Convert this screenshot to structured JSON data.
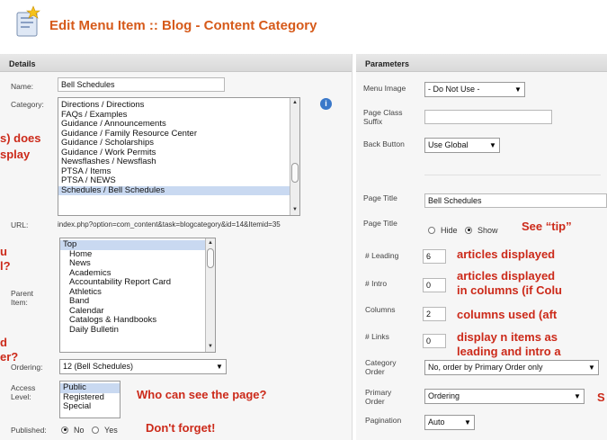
{
  "header": {
    "title": "Edit Menu Item :: Blog - Content Category"
  },
  "details": {
    "heading": "Details",
    "name_label": "Name:",
    "name_value": "Bell Schedules",
    "category_label": "Category:",
    "category_items": [
      "Directions / Directions",
      "FAQs / Examples",
      "Guidance / Announcements",
      "Guidance / Family Resource Center",
      "Guidance / Scholarships",
      "Guidance / Work Permits",
      "Newsflashes / Newsflash",
      "PTSA / Items",
      "PTSA / NEWS",
      "Schedules / Bell Schedules"
    ],
    "category_selected": "Schedules / Bell Schedules",
    "url_label": "URL:",
    "url_value": "index.php?option=com_content&task=blogcategory&id=14&Itemid=35",
    "parent_label": "Parent Item:",
    "parent_items": [
      "Top",
      "Home",
      "News",
      "Academics",
      "Accountability Report Card",
      "Athletics",
      "Band",
      "Calendar",
      "Catalogs & Handbooks",
      "Daily Bulletin"
    ],
    "parent_selected": "Top",
    "ordering_label": "Ordering:",
    "ordering_value": "12 (Bell Schedules)",
    "access_label": "Access Level:",
    "access_items": [
      "Public",
      "Registered",
      "Special"
    ],
    "access_selected": "Public",
    "published_label": "Published:",
    "published_no": "No",
    "published_yes": "Yes",
    "published_value": "No"
  },
  "parameters": {
    "heading": "Parameters",
    "menu_image_label": "Menu Image",
    "menu_image_value": "- Do Not Use -",
    "page_class_label": "Page Class Suffix",
    "page_class_value": "",
    "back_button_label": "Back Button",
    "back_button_value": "Use Global",
    "page_title_label": "Page Title",
    "page_title_value": "Bell Schedules",
    "page_title2_label": "Page Title",
    "page_title_hide": "Hide",
    "page_title_show": "Show",
    "page_title_choice": "Show",
    "leading_label": "# Leading",
    "leading_value": "6",
    "intro_label": "# Intro",
    "intro_value": "0",
    "columns_label": "Columns",
    "columns_value": "2",
    "links_label": "# Links",
    "links_value": "0",
    "category_order_label": "Category Order",
    "category_order_value": "No, order by Primary Order only",
    "primary_order_label": "Primary Order",
    "primary_order_value": "Ordering",
    "pagination_label": "Pagination",
    "pagination_value": "Auto"
  },
  "annotations": {
    "left_does": "s) does",
    "left_splay": "splay",
    "left_u": "u",
    "left_l": "l?",
    "left_d": "d",
    "left_er": "er?",
    "who_can_see": "Who can see the page?",
    "dont_forget": "Don't forget!",
    "see_tip": "See “tip”",
    "articles_displayed_1": "articles displayed",
    "articles_displayed_2": "articles displayed",
    "in_columns": "in columns (if Colu",
    "columns_used": "columns used (aft",
    "display_n_items": "display n items as",
    "leading_and_intro": "leading and intro a",
    "s_right": "S"
  },
  "colors": {
    "title": "#d65a1a",
    "annotation": "#cc2a1a",
    "selection": "#c9d9f1",
    "info": "#3a78c9"
  }
}
